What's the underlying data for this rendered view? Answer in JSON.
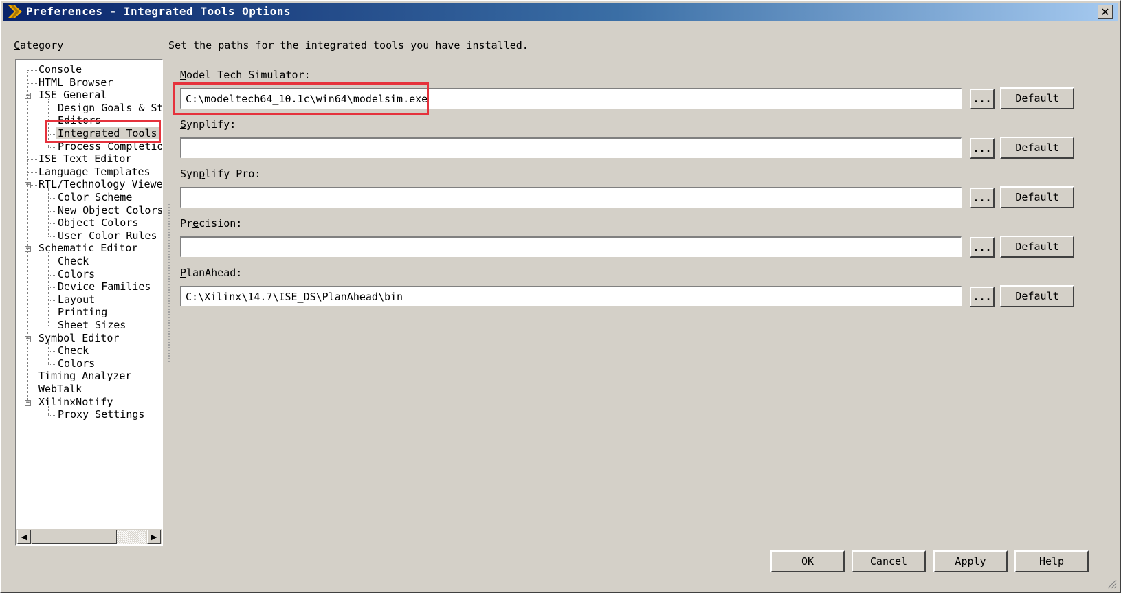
{
  "window": {
    "title": "Preferences - Integrated Tools Options"
  },
  "category": {
    "label": "Category",
    "mnemonic": "C"
  },
  "tree": {
    "items": [
      {
        "label": "Console",
        "level": 1
      },
      {
        "label": "HTML Browser",
        "level": 1
      },
      {
        "label": "ISE General",
        "level": 1,
        "expanded": true
      },
      {
        "label": "Design Goals & St",
        "level": 2
      },
      {
        "label": "Editors",
        "level": 2
      },
      {
        "label": "Integrated Tools",
        "level": 2,
        "selected": true
      },
      {
        "label": "Process Completio",
        "level": 2
      },
      {
        "label": "ISE Text Editor",
        "level": 1
      },
      {
        "label": "Language Templates",
        "level": 1
      },
      {
        "label": "RTL/Technology Viewer",
        "level": 1,
        "expanded": true
      },
      {
        "label": "Color Scheme",
        "level": 2
      },
      {
        "label": "New Object Colors",
        "level": 2
      },
      {
        "label": "Object Colors",
        "level": 2
      },
      {
        "label": "User Color Rules",
        "level": 2
      },
      {
        "label": "Schematic Editor",
        "level": 1,
        "expanded": true
      },
      {
        "label": "Check",
        "level": 2
      },
      {
        "label": "Colors",
        "level": 2
      },
      {
        "label": "Device Families",
        "level": 2
      },
      {
        "label": "Layout",
        "level": 2
      },
      {
        "label": "Printing",
        "level": 2
      },
      {
        "label": "Sheet Sizes",
        "level": 2
      },
      {
        "label": "Symbol Editor",
        "level": 1,
        "expanded": true
      },
      {
        "label": "Check",
        "level": 2
      },
      {
        "label": "Colors",
        "level": 2
      },
      {
        "label": "Timing Analyzer",
        "level": 1
      },
      {
        "label": "WebTalk",
        "level": 1
      },
      {
        "label": "XilinxNotify",
        "level": 1,
        "expanded": true
      },
      {
        "label": "Proxy Settings",
        "level": 2
      }
    ]
  },
  "main": {
    "description": "Set the paths for the integrated tools you have installed.",
    "fields": [
      {
        "mnemonic": "M",
        "rest": "odel Tech Simulator:",
        "value": "C:\\modeltech64_10.1c\\win64\\modelsim.exe"
      },
      {
        "mnemonic": "S",
        "rest": "ynplify:",
        "value": ""
      },
      {
        "pre": "Syn",
        "mnemonic": "p",
        "rest": "lify Pro:",
        "value": ""
      },
      {
        "pre": "Pr",
        "mnemonic": "e",
        "rest": "cision:",
        "value": ""
      },
      {
        "mnemonic": "P",
        "rest": "lanAhead:",
        "value": "C:\\Xilinx\\14.7\\ISE_DS\\PlanAhead\\bin"
      }
    ],
    "browse_label": "...",
    "default_label": "Default"
  },
  "buttons": {
    "ok": "OK",
    "cancel": "Cancel",
    "apply": "Apply",
    "apply_mnemonic": "A",
    "apply_rest": "pply",
    "help": "Help"
  },
  "icons": {
    "logo": "xilinx-logo-icon",
    "close": "close-icon",
    "scroll_left": "scroll-left-icon",
    "scroll_right": "scroll-right-icon",
    "resize": "resize-grip-icon"
  },
  "colors": {
    "highlight": "#e5323c",
    "titlebar_start": "#0a246a",
    "titlebar_end": "#a6caf0",
    "dialog_bg": "#d4d0c8"
  }
}
